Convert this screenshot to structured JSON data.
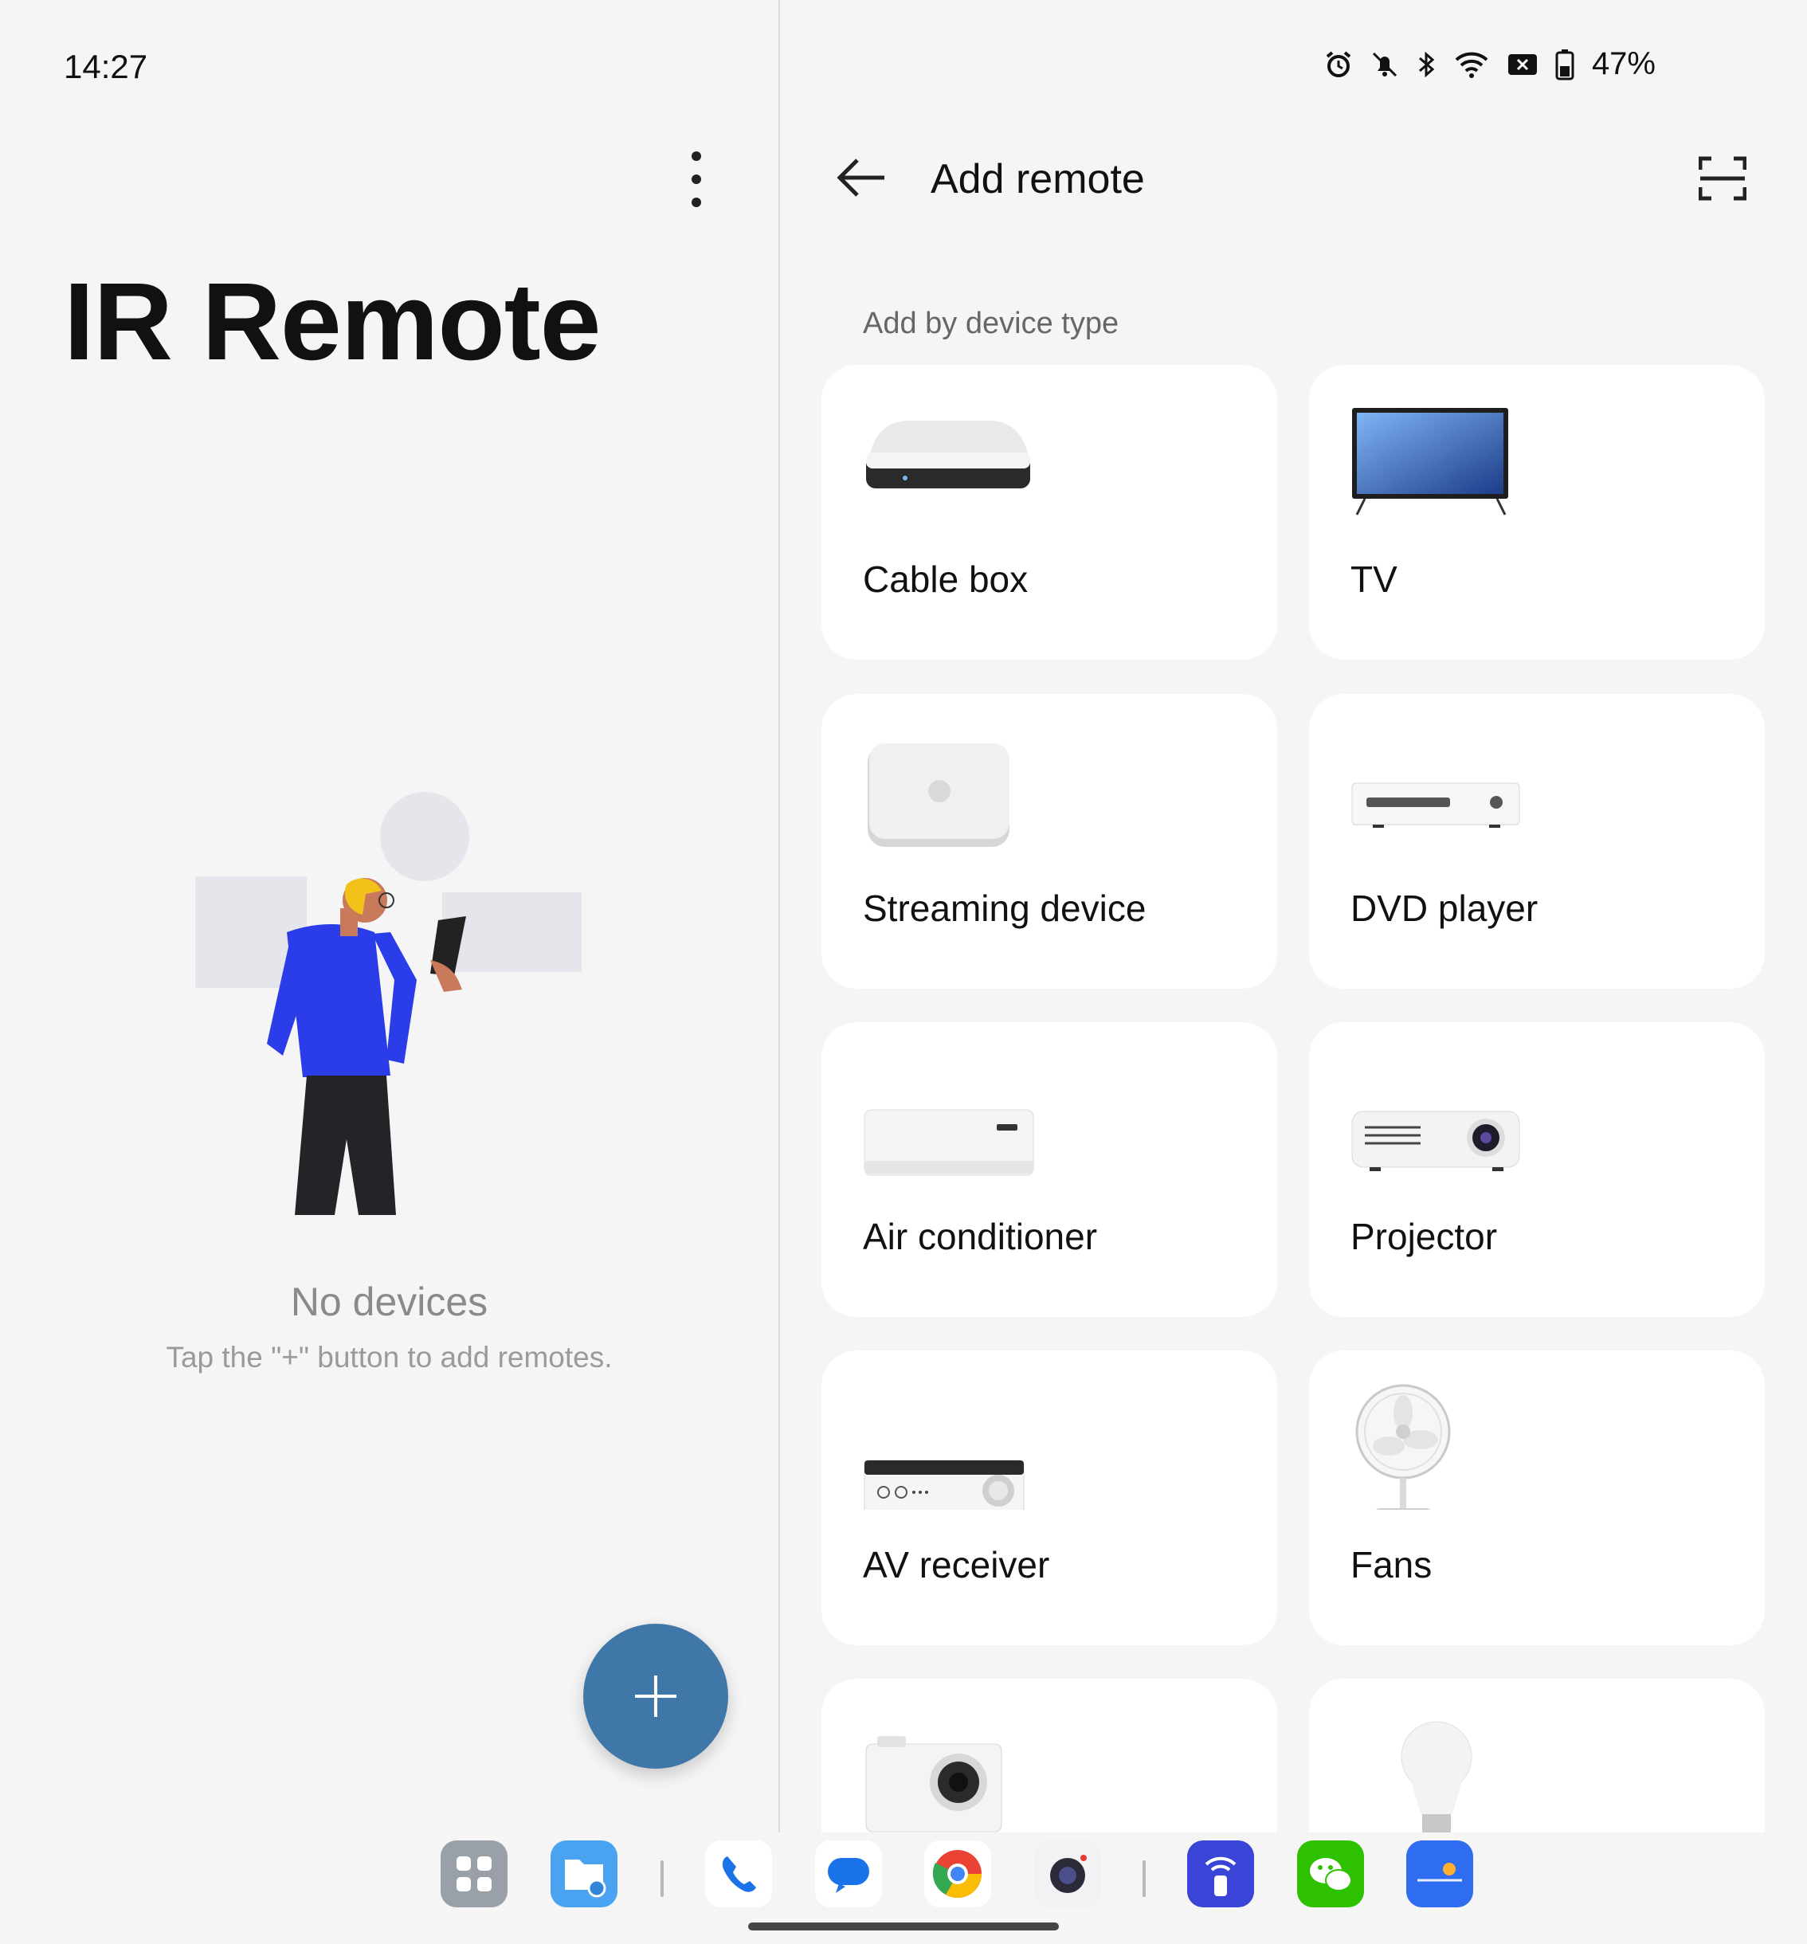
{
  "status_bar": {
    "time": "14:27",
    "battery": "47%",
    "icons": [
      "alarm-icon",
      "bell-off-icon",
      "bluetooth-icon",
      "wifi-icon",
      "no-sim-icon",
      "battery-icon"
    ]
  },
  "left_pane": {
    "title": "IR Remote",
    "empty_title": "No devices",
    "empty_subtitle": "Tap the \"+\" button to add remotes.",
    "fab_icon": "plus-icon",
    "menu_icon": "more-vertical-icon"
  },
  "right_pane": {
    "title": "Add remote",
    "back_icon": "arrow-left-icon",
    "scan_icon": "scan-icon",
    "section_label": "Add by device type",
    "devices": [
      {
        "label": "Cable box",
        "icon": "cable-box-icon"
      },
      {
        "label": "TV",
        "icon": "tv-icon"
      },
      {
        "label": "Streaming device",
        "icon": "streaming-device-icon"
      },
      {
        "label": "DVD player",
        "icon": "dvd-player-icon"
      },
      {
        "label": "Air conditioner",
        "icon": "air-conditioner-icon"
      },
      {
        "label": "Projector",
        "icon": "projector-icon"
      },
      {
        "label": "AV receiver",
        "icon": "av-receiver-icon"
      },
      {
        "label": "Fans",
        "icon": "fan-icon"
      },
      {
        "label": "",
        "icon": "camera-icon"
      },
      {
        "label": "",
        "icon": "light-bulb-icon"
      }
    ]
  },
  "dock": {
    "apps": [
      "app-drawer-icon",
      "files-icon",
      "phone-icon",
      "messages-icon",
      "chrome-icon",
      "camera-app-icon",
      "remote-app-icon",
      "wechat-icon",
      "weather-icon"
    ]
  },
  "colors": {
    "fab": "#3f77a8",
    "background": "#f5f5f5",
    "card": "#ffffff"
  }
}
